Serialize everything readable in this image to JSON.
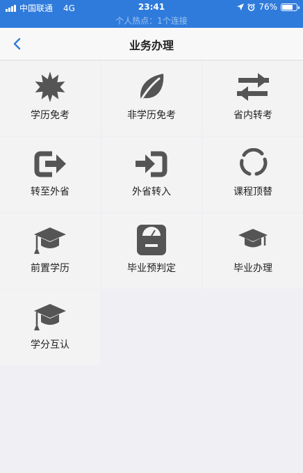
{
  "status_bar": {
    "carrier": "中国联通",
    "network": "4G",
    "time": "23:41",
    "battery": "76%",
    "battery_level": 0.76,
    "hotspot": "个人热点：1个连接"
  },
  "navbar": {
    "title": "业务办理"
  },
  "colors": {
    "status_bg": "#2f7bdc",
    "accent": "#2f7bdc",
    "icon": "#555555"
  },
  "services": [
    {
      "label": "学历免考",
      "icon": "starburst-icon"
    },
    {
      "label": "非学历免考",
      "icon": "leaf-icon"
    },
    {
      "label": "省内转考",
      "icon": "transfer-arrows-icon"
    },
    {
      "label": "转至外省",
      "icon": "exit-arrow-icon"
    },
    {
      "label": "外省转入",
      "icon": "enter-arrow-icon"
    },
    {
      "label": "课程顶替",
      "icon": "circular-arrows-icon"
    },
    {
      "label": "前置学历",
      "icon": "graduation-cap-icon"
    },
    {
      "label": "毕业预判定",
      "icon": "scale-icon"
    },
    {
      "label": "毕业办理",
      "icon": "graduation-cap-icon"
    },
    {
      "label": "学分互认",
      "icon": "graduation-cap-icon"
    }
  ]
}
